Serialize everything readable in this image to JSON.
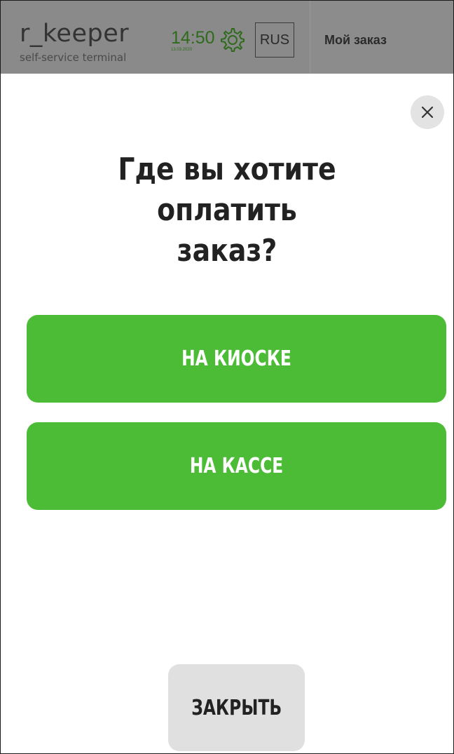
{
  "header": {
    "logo": "r_keeper",
    "logo_subtitle": "self-service terminal",
    "time": "14:50",
    "date": "13.03.2020",
    "language": "RUS",
    "order_title": "Мой заказ",
    "icons": {
      "settings": "gear-icon"
    },
    "colors": {
      "background": "#8a8a8a",
      "time": "#2f6b1c"
    }
  },
  "dialog": {
    "title_line1": "Где вы хотите оплатить",
    "title_line2": "заказ?",
    "close_icon": "close-icon",
    "options": [
      {
        "label": "НА КИОСКЕ"
      },
      {
        "label": "НА КАССЕ"
      }
    ],
    "close_label": "ЗАКРЫТЬ",
    "colors": {
      "option_background": "#4cbc36",
      "option_text": "#ffffff",
      "close_background": "#e0e0e0"
    }
  }
}
